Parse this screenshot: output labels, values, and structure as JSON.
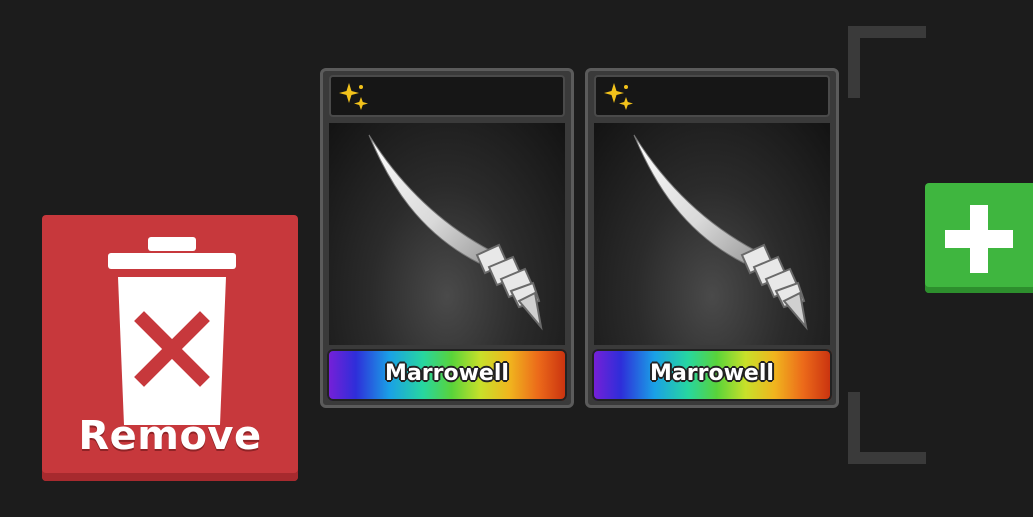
{
  "actions": {
    "remove_label": "Remove"
  },
  "slots": [
    {
      "name": "Marrowell",
      "rarity_icon": "sparkle-icon",
      "weapon_icon": "curved-blade-icon"
    },
    {
      "name": "Marrowell",
      "rarity_icon": "sparkle-icon",
      "weapon_icon": "curved-blade-icon"
    }
  ],
  "colors": {
    "background": "#1c1c1c",
    "remove": "#c7383c",
    "add": "#3fb63f",
    "sparkle": "#f2c21b"
  }
}
